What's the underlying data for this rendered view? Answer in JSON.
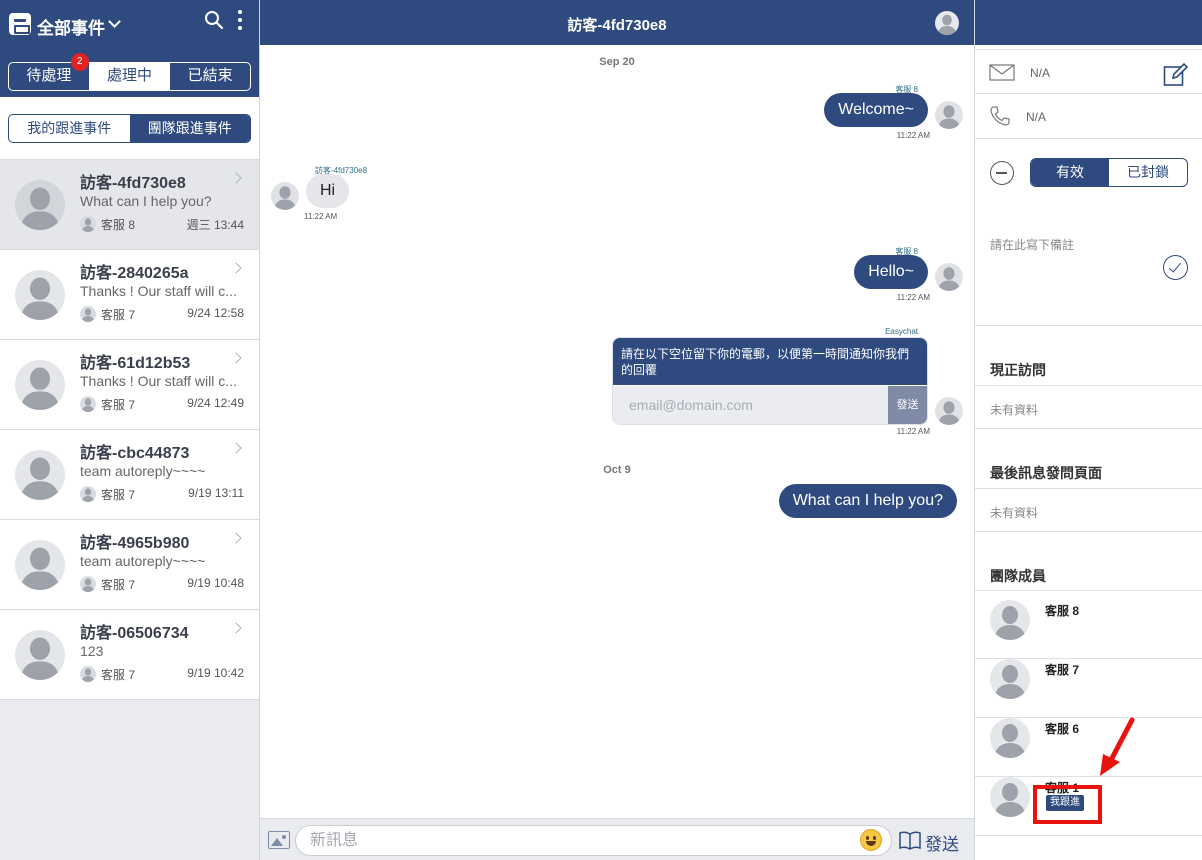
{
  "left": {
    "title": "全部事件",
    "status_tabs": [
      {
        "label": "待處理",
        "badge": "2"
      },
      {
        "label": "處理中"
      },
      {
        "label": "已結束"
      }
    ],
    "follow_tabs": [
      "我的跟進事件",
      "團隊跟進事件"
    ],
    "conversations": [
      {
        "name": "訪客-4fd730e8",
        "preview": "What can I help you?",
        "agent": "客服 8",
        "time": "週三 13:44"
      },
      {
        "name": "訪客-2840265a",
        "preview": "Thanks ! Our staff will c...",
        "agent": "客服 7",
        "time": "9/24 12:58"
      },
      {
        "name": "訪客-61d12b53",
        "preview": "Thanks ! Our staff will c...",
        "agent": "客服 7",
        "time": "9/24 12:49"
      },
      {
        "name": "訪客-cbc44873",
        "preview": "team autoreply~~~~",
        "agent": "客服 7",
        "time": "9/19 13:11"
      },
      {
        "name": "訪客-4965b980",
        "preview": "team autoreply~~~~",
        "agent": "客服 7",
        "time": "9/19 10:48"
      },
      {
        "name": "訪客-06506734",
        "preview": "123",
        "agent": "客服 7",
        "time": "9/19 10:42"
      }
    ]
  },
  "chat": {
    "title": "訪客-4fd730e8",
    "date1": "Sep 20",
    "date2": "Oct 9",
    "m1": {
      "sender": "客服 8",
      "text": "Welcome~",
      "time": "11:22 AM"
    },
    "m2": {
      "sender": "訪客-4fd730e8",
      "text": "Hi",
      "time": "11:22 AM"
    },
    "m3": {
      "sender": "客服 8",
      "text": "Hello~",
      "time": "11:22 AM"
    },
    "m4": {
      "sender": "Easychat",
      "text": "請在以下空位留下你的電郵，以便第一時間通知你我們的回覆",
      "placeholder": "email@domain.com",
      "send": "發送",
      "time": "11:22 AM"
    },
    "m5": {
      "text": "What can I help you?"
    },
    "composer": {
      "placeholder": "新訊息",
      "send": "發送"
    }
  },
  "right": {
    "email": "N/A",
    "phone": "N/A",
    "status_tabs": [
      "有效",
      "已封鎖"
    ],
    "note_placeholder": "請在此寫下備註",
    "current_visit": {
      "title": "現正訪問",
      "value": "未有資料"
    },
    "last_page": {
      "title": "最後訊息發問頁面",
      "value": "未有資料"
    },
    "team": {
      "title": "團隊成員",
      "members": [
        "客服 8",
        "客服 7",
        "客服 6",
        "客服 1"
      ],
      "follow_badge": "我跟進"
    }
  },
  "colors": {
    "primary": "#2f4a7f",
    "badge": "#e02424",
    "highlight": "#e8130d"
  }
}
